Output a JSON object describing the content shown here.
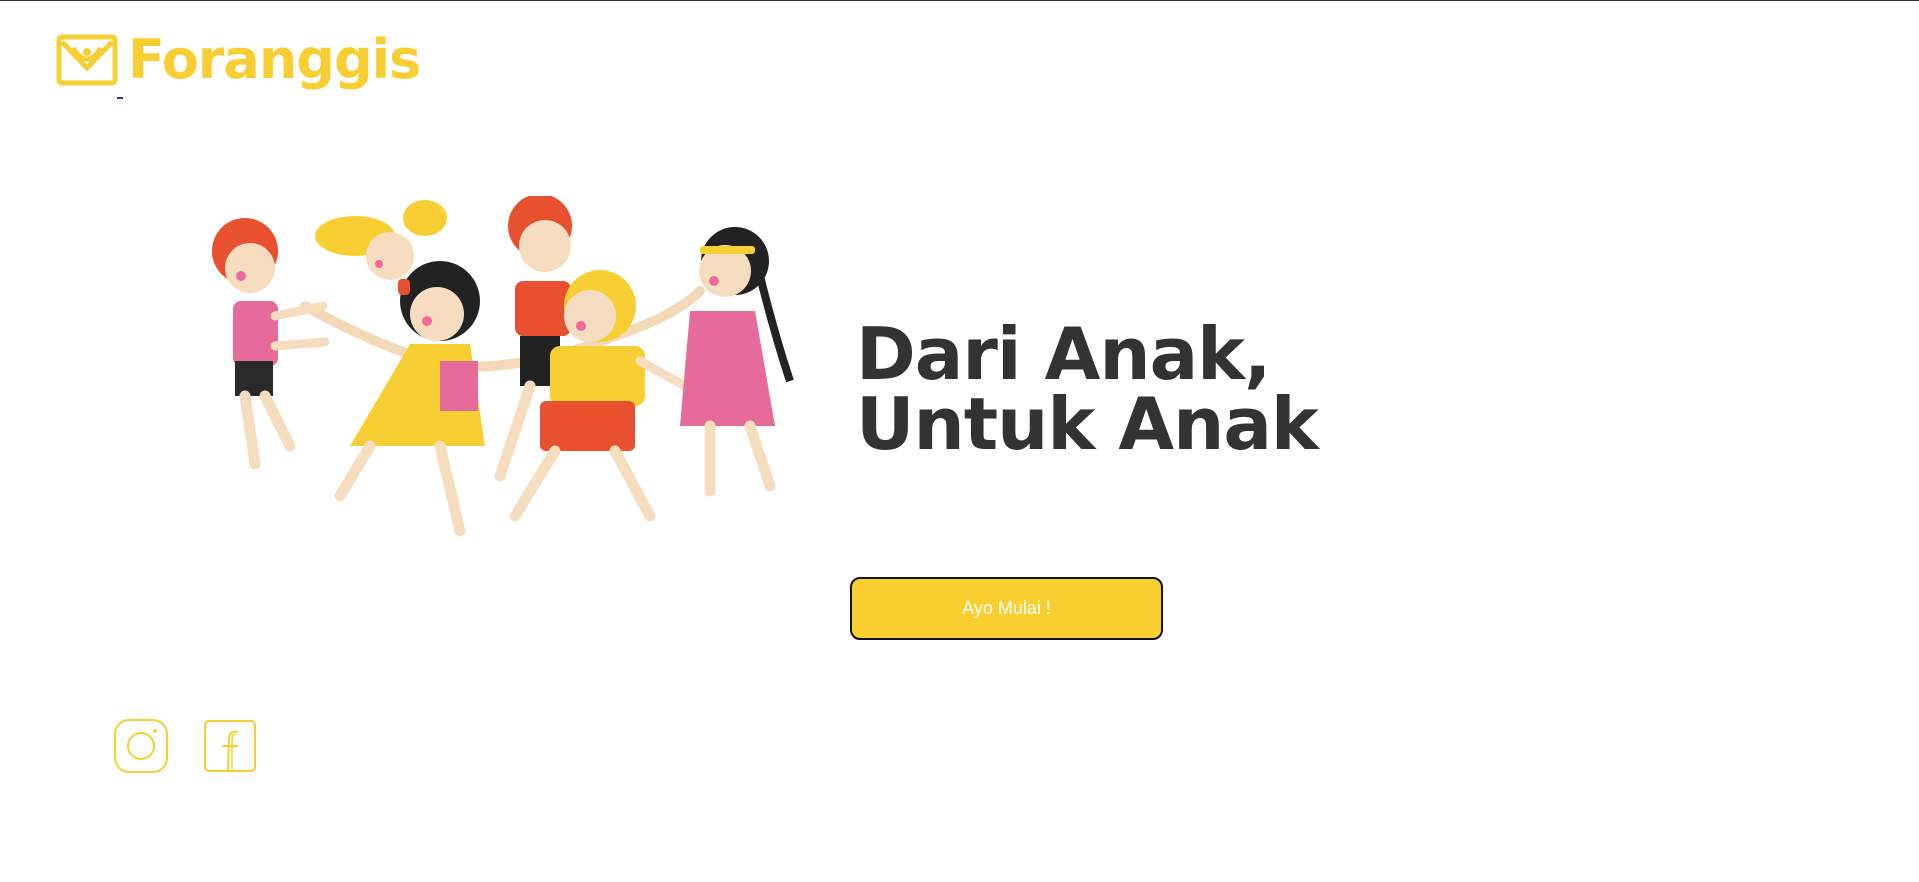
{
  "brand": {
    "name": "Foranggis",
    "color": "#F8CF33",
    "logo_icon": "smile-envelope-icon"
  },
  "hero": {
    "headline_line1": "Dari Anak,",
    "headline_line2": "Untuk Anak",
    "illustration": "children-playing-circle-illustration",
    "cta_label": "Ayo Mulai !",
    "cta_color": "#F8CF2E"
  },
  "social": {
    "items": [
      {
        "icon": "instagram-icon"
      },
      {
        "icon": "facebook-icon"
      }
    ],
    "color": "#F8CF33"
  }
}
